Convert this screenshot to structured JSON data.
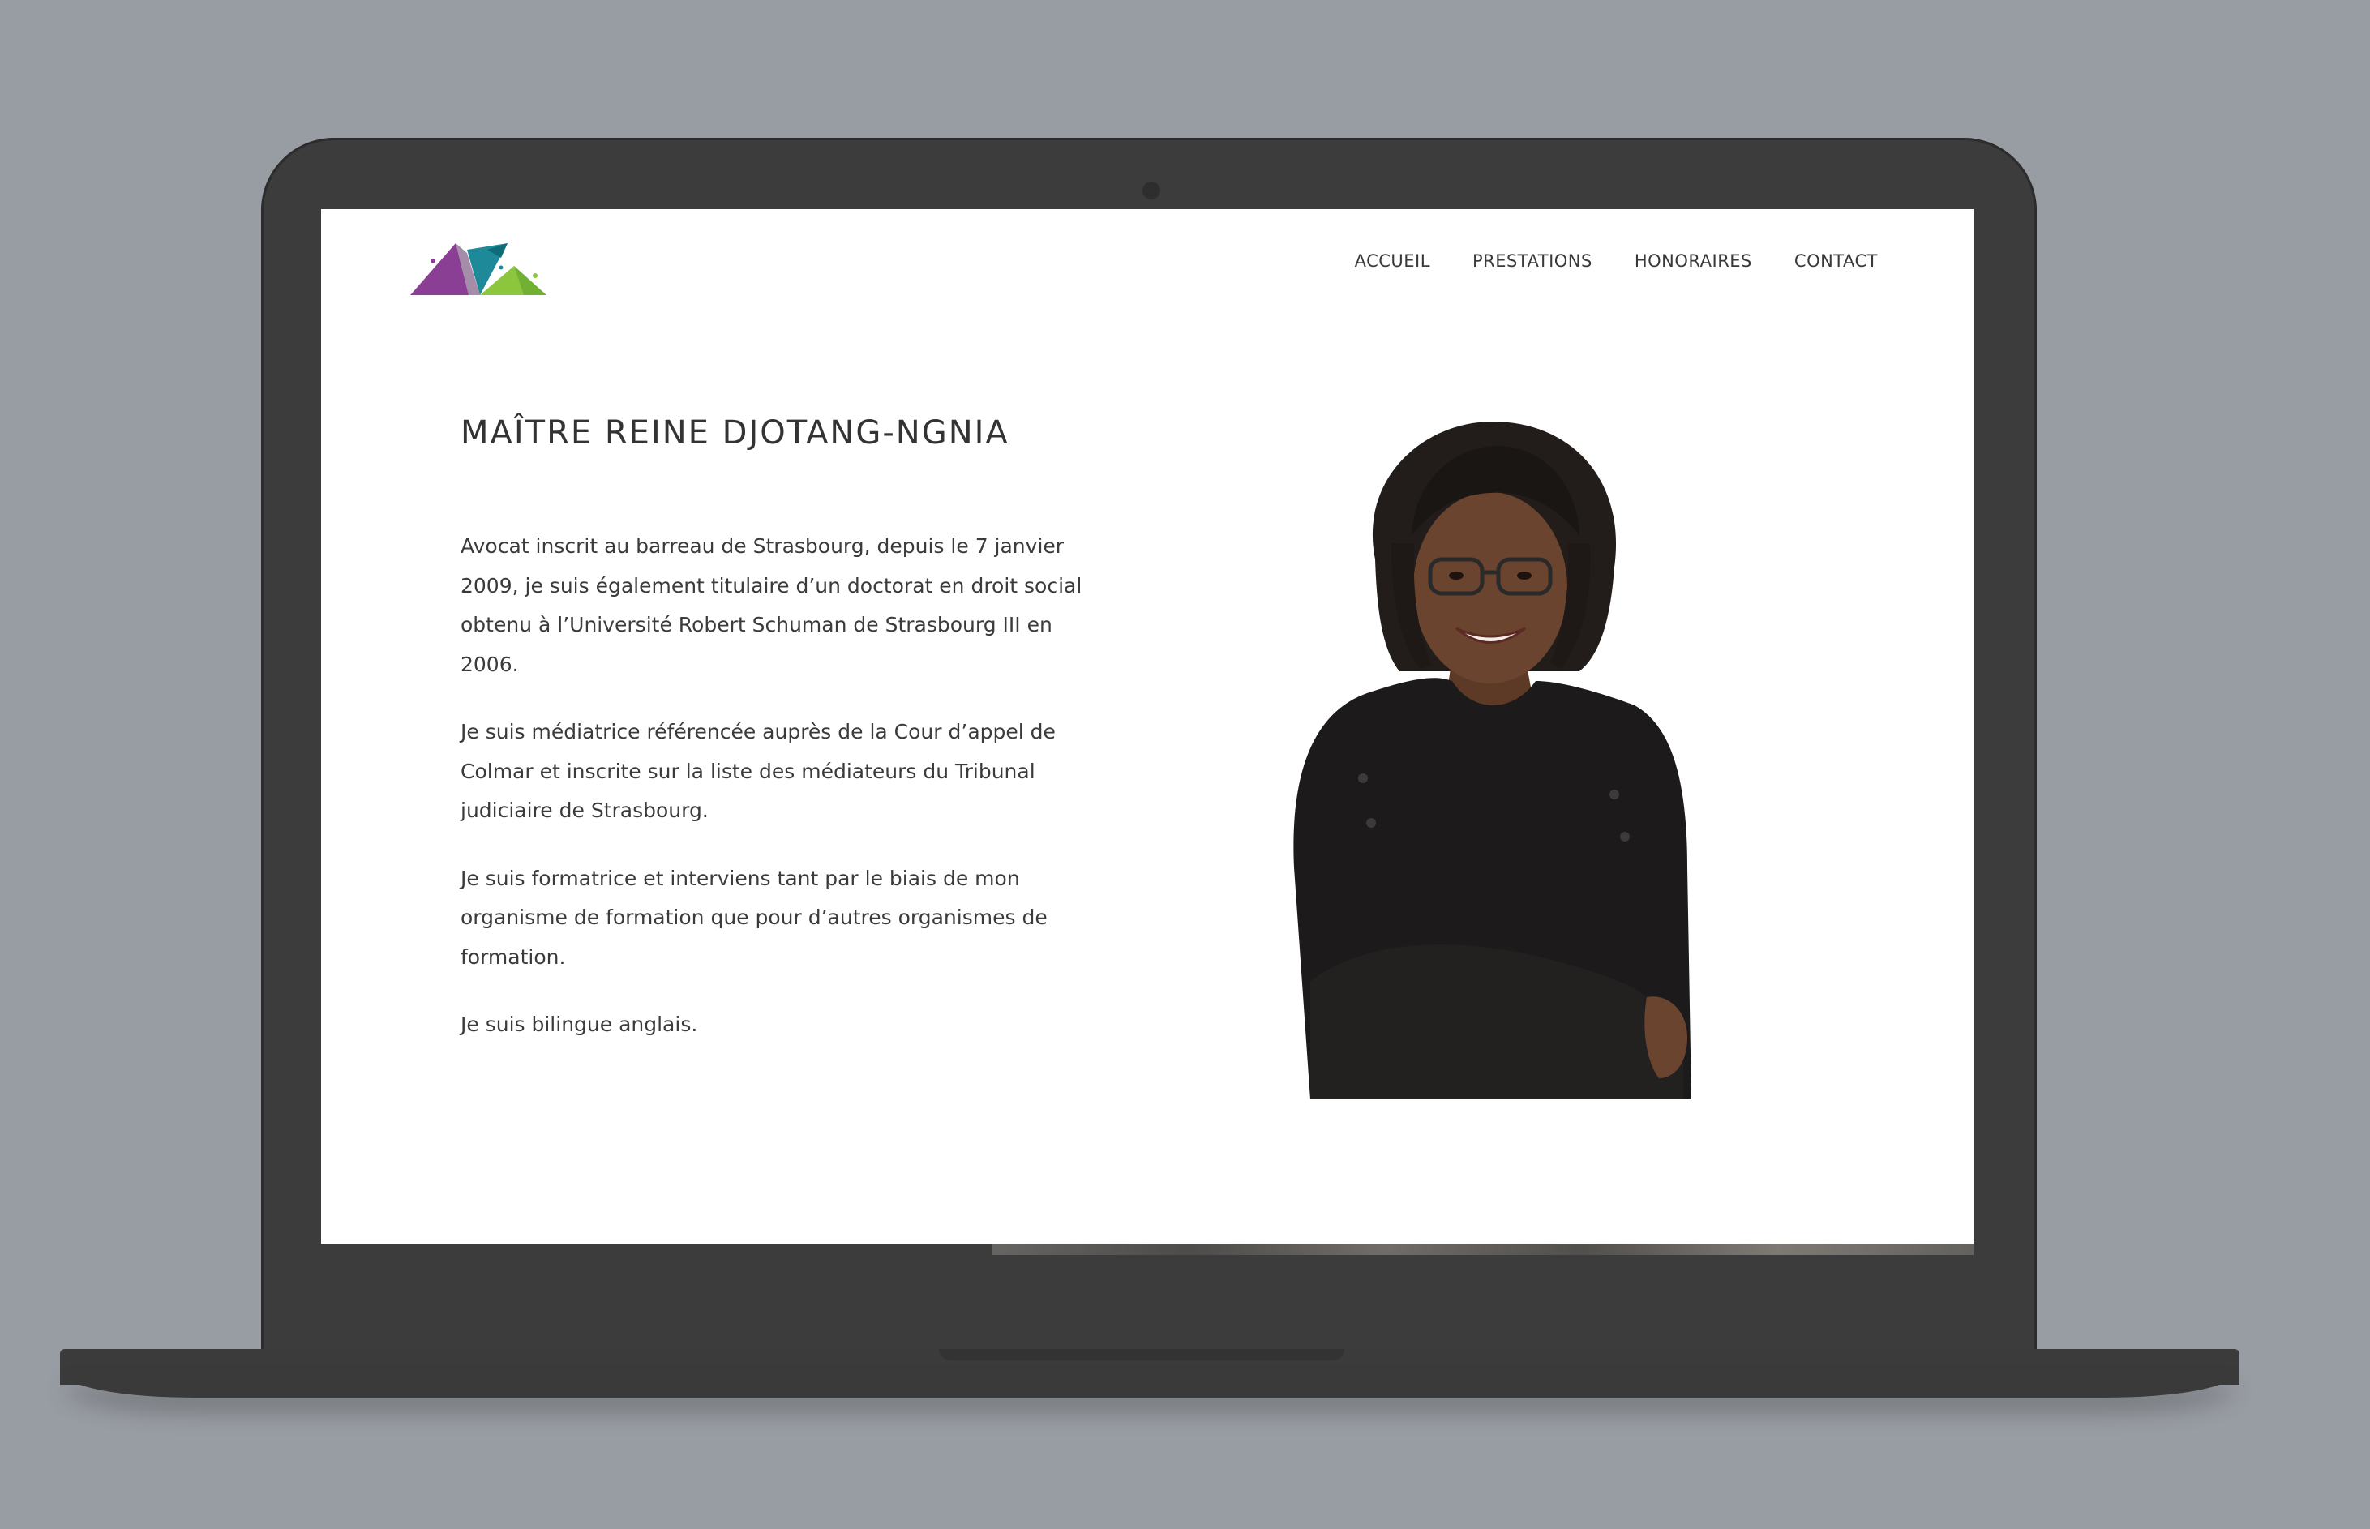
{
  "nav": {
    "items": [
      {
        "label": "ACCUEIL"
      },
      {
        "label": "PRESTATIONS"
      },
      {
        "label": "HONORAIRES"
      },
      {
        "label": "CONTACT"
      }
    ]
  },
  "main": {
    "title": "MAÎTRE REINE DJOTANG-NGNIA",
    "paragraphs": [
      "Avocat inscrit au barreau de Strasbourg, depuis le 7 janvier 2009, je suis également titulaire d’un doctorat en droit social obtenu à l’Université Robert Schuman de Strasbourg III en 2006.",
      "Je suis médiatrice référencée auprès de la Cour d’appel de Colmar et inscrite sur la liste des médiateurs du Tribunal judiciaire de Strasbourg.",
      "Je suis formatrice et interviens tant par le biais de mon organisme de formation que pour d’autres organismes de formation.",
      "Je suis bilingue anglais."
    ]
  },
  "colors": {
    "background": "#989ca3",
    "laptop": "#3c3c3c",
    "logo_purple": "#8a3f94",
    "logo_teal": "#1e8a99",
    "logo_green": "#8cc63f"
  }
}
